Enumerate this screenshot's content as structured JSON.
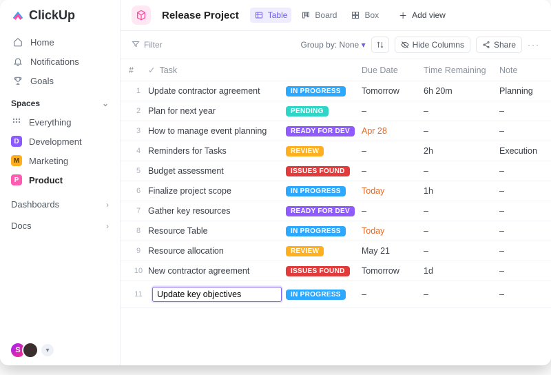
{
  "brand": "ClickUp",
  "sidebar": {
    "nav": [
      {
        "label": "Home",
        "icon": "home-icon"
      },
      {
        "label": "Notifications",
        "icon": "bell-icon"
      },
      {
        "label": "Goals",
        "icon": "trophy-icon"
      }
    ],
    "spaces_title": "Spaces",
    "spaces": [
      {
        "label": "Everything",
        "badge": "",
        "color": "e"
      },
      {
        "label": "Development",
        "badge": "D",
        "color": "d"
      },
      {
        "label": "Marketing",
        "badge": "M",
        "color": "m"
      },
      {
        "label": "Product",
        "badge": "P",
        "color": "p",
        "selected": true
      }
    ],
    "links": [
      {
        "label": "Dashboards"
      },
      {
        "label": "Docs"
      }
    ],
    "avatars": [
      {
        "initial": "S"
      },
      {
        "initial": ""
      }
    ]
  },
  "header": {
    "project_title": "Release Project",
    "views": [
      {
        "label": "Table",
        "active": true
      },
      {
        "label": "Board",
        "active": false
      },
      {
        "label": "Box",
        "active": false
      }
    ],
    "add_view": "Add view"
  },
  "toolbar": {
    "filter_label": "Filter",
    "group_by_label": "Group by:",
    "group_by_value": "None",
    "hide_columns": "Hide Columns",
    "share": "Share"
  },
  "table": {
    "columns": [
      "#",
      "Task",
      "",
      "Due Date",
      "Time Remaining",
      "Note"
    ],
    "status_styles": {
      "IN PROGRESS": "in_progress",
      "PENDING": "pending",
      "READY FOR DEV": "ready_for_dev",
      "REVIEW": "review",
      "ISSUES FOUND": "issues_found"
    },
    "rows": [
      {
        "n": 1,
        "task": "Update contractor agreement",
        "status": "IN PROGRESS",
        "due": "Tomorrow",
        "due_warn": false,
        "time": "6h 20m",
        "note": "Planning"
      },
      {
        "n": 2,
        "task": "Plan for next year",
        "status": "PENDING",
        "due": "–",
        "due_warn": false,
        "time": "–",
        "note": "–"
      },
      {
        "n": 3,
        "task": "How to manage event planning",
        "status": "READY FOR DEV",
        "due": "Apr 28",
        "due_warn": true,
        "time": "–",
        "note": "–"
      },
      {
        "n": 4,
        "task": "Reminders for Tasks",
        "status": "REVIEW",
        "due": "–",
        "due_warn": false,
        "time": "2h",
        "note": "Execution"
      },
      {
        "n": 5,
        "task": "Budget assessment",
        "status": "ISSUES FOUND",
        "due": "–",
        "due_warn": false,
        "time": "–",
        "note": "–"
      },
      {
        "n": 6,
        "task": "Finalize project scope",
        "status": "IN PROGRESS",
        "due": "Today",
        "due_warn": true,
        "time": "1h",
        "note": "–"
      },
      {
        "n": 7,
        "task": "Gather key resources",
        "status": "READY FOR DEV",
        "due": "–",
        "due_warn": false,
        "time": "–",
        "note": "–"
      },
      {
        "n": 8,
        "task": "Resource Table",
        "status": "IN PROGRESS",
        "due": "Today",
        "due_warn": true,
        "time": "–",
        "note": "–"
      },
      {
        "n": 9,
        "task": "Resource allocation",
        "status": "REVIEW",
        "due": "May 21",
        "due_warn": false,
        "time": "–",
        "note": "–"
      },
      {
        "n": 10,
        "task": "New contractor agreement",
        "status": "ISSUES FOUND",
        "due": "Tomorrow",
        "due_warn": false,
        "time": "1d",
        "note": "–"
      },
      {
        "n": 11,
        "task": "Update key objectives",
        "status": "IN PROGRESS",
        "due": "–",
        "due_warn": false,
        "time": "–",
        "note": "–",
        "editing": true
      }
    ]
  }
}
